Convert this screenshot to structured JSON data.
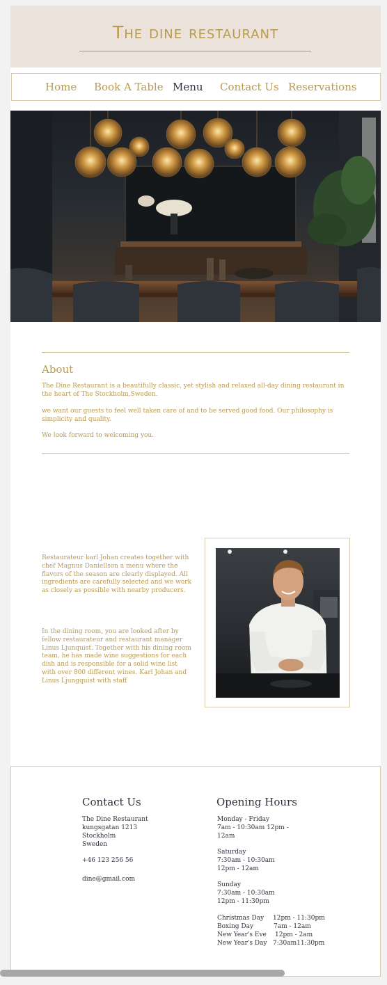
{
  "header": {
    "title": "The dine restaurant"
  },
  "nav": {
    "items": [
      {
        "label": "Home"
      },
      {
        "label": "Book A Table"
      },
      {
        "label": "Menu"
      },
      {
        "label": "Contact Us"
      },
      {
        "label": "Reservations"
      }
    ],
    "active": "Menu"
  },
  "about": {
    "title": "About",
    "p1": "The Dine Restaurant  is a beautifully classic, yet stylish and relaxed all-day dining restaurant in the heart of The Stockholm,Sweden.",
    "p2": "we want our guests to feel well taken care of and to be served good food. Our philosophy is simplicity and quality.",
    "p3": "We look forward to welcoming you."
  },
  "story": {
    "p1": "Restaurateur karl Johan creates together with chef Magnus Daniellson a menu where the flavors of the season are clearly displayed. All ingredients are carefully selected and we work as closely as possible with nearby producers.",
    "p2": "In the dining room, you are looked after by fellow restaurateur and restaurant manager Linus Ljunquist. Together with his dining room team, he has made wine suggestions for each dish and is responsible for a solid wine list with over 800 different wines. Karl Johan and Linus Ljungquist with staff"
  },
  "contact": {
    "title": "Contact Us",
    "address": [
      "The Dine Restaurant",
      "kungsgatan 1213",
      "Stockholm",
      "Sweden"
    ],
    "phone": "+46 123 256 56",
    "email": "dine@gmail.com"
  },
  "hours": {
    "title": "Opening Hours",
    "weekday_label": "Monday - Friday",
    "weekday_times": [
      "7am - 10:30am 12pm -",
      "12am"
    ],
    "saturday_label": "Saturday",
    "saturday_times": [
      "7:30am - 10:30am",
      "12pm - 12am"
    ],
    "sunday_label": "Sunday",
    "sunday_times": [
      "7:30am - 10:30am",
      "12pm - 11:30pm"
    ],
    "holidays": [
      {
        "day": "Christmas Day",
        "time": "12pm - 11:30pm"
      },
      {
        "day": "Boxing Day",
        "time": "7am - 12am"
      },
      {
        "day": "New Year's Eve",
        "time": "12pm - 2am"
      },
      {
        "day": "New Year's Day",
        "time": "7:30am11:30pm"
      }
    ]
  },
  "images": {
    "hero": "restaurant-dining-room-photo",
    "chef": "chef-portrait-photo"
  },
  "colors": {
    "accent": "#b99a4e",
    "header_bg": "#eae2db",
    "text_dark": "#2e3340"
  }
}
